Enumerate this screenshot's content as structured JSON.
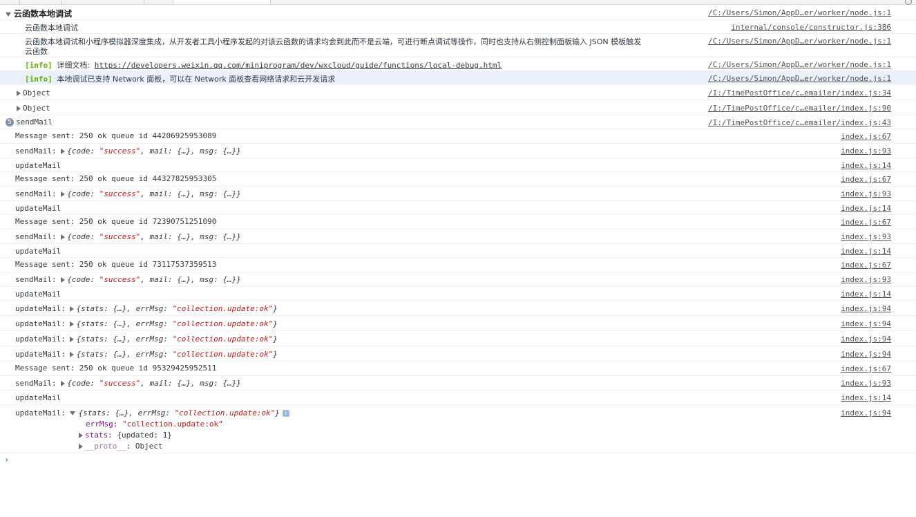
{
  "group": {
    "title": "云函数本地调试",
    "source": "/C:/Users/Simon/AppD…er/worker/node.js:1",
    "lines": [
      {
        "text": "云函数本地调试",
        "source": "internal/console/constructor.js:386"
      },
      {
        "text_1": "云函数本地调试和小程序模拟器深度集成，从开发者工具小程序发起的对该云函数的请求均会到此而不是云端，可进行断点调试等操作，同时也支持从右侧控制面板输入 JSON 模板触发",
        "text_2": "云函数",
        "source": "/C:/Users/Simon/AppD…er/worker/node.js:1"
      },
      {
        "tag": "[info]",
        "label": "详细文档:",
        "url": "https://developers.weixin.qq.com/miniprogram/dev/wxcloud/guide/functions/local-debug.html",
        "source": "/C:/Users/Simon/AppD…er/worker/node.js:1"
      },
      {
        "tag": "[info]",
        "text": "本地调试已支持 Network 面板，可以在 Network 面板查看网络请求和云开发请求",
        "source": "/C:/Users/Simon/AppD…er/worker/node.js:1"
      }
    ]
  },
  "objects": [
    {
      "text": "Object",
      "source": "/I:/TimePostOffice/c…emailer/index.js:34"
    },
    {
      "text": "Object",
      "source": "/I:/TimePostOffice/c…emailer/index.js:90"
    }
  ],
  "sendmail_group": {
    "count": "5",
    "text": "sendMail",
    "source": "/I:/TimePostOffice/c…emailer/index.js:43"
  },
  "logs": [
    {
      "text": "Message sent: 250 ok queue id 44206925953089",
      "source": "index.js:67"
    },
    {
      "label": "sendMail:",
      "open": "{",
      "k1": "code",
      "v1": "\"success\"",
      "rest": ", mail: {…}, msg: {…}}",
      "source": "index.js:93"
    },
    {
      "text": "updateMail",
      "source": "index.js:14"
    },
    {
      "text": "Message sent: 250 ok queue id 44327825953305",
      "source": "index.js:67"
    },
    {
      "label": "sendMail:",
      "open": "{",
      "k1": "code",
      "v1": "\"success\"",
      "rest": ", mail: {…}, msg: {…}}",
      "source": "index.js:93"
    },
    {
      "text": "updateMail",
      "source": "index.js:14"
    },
    {
      "text": "Message sent: 250 ok queue id 72390751251090",
      "source": "index.js:67"
    },
    {
      "label": "sendMail:",
      "open": "{",
      "k1": "code",
      "v1": "\"success\"",
      "rest": ", mail: {…}, msg: {…}}",
      "source": "index.js:93"
    },
    {
      "text": "updateMail",
      "source": "index.js:14"
    },
    {
      "text": "Message sent: 250 ok queue id 73117537359513",
      "source": "index.js:67"
    },
    {
      "label": "sendMail:",
      "open": "{",
      "k1": "code",
      "v1": "\"success\"",
      "rest": ", mail: {…}, msg: {…}}",
      "source": "index.js:93"
    },
    {
      "text": "updateMail",
      "source": "index.js:14"
    },
    {
      "label": "updateMail:",
      "pre": "{stats: {…}, errMsg: ",
      "val": "\"collection.update:ok\"",
      "post": "}",
      "source": "index.js:94"
    },
    {
      "label": "updateMail:",
      "pre": "{stats: {…}, errMsg: ",
      "val": "\"collection.update:ok\"",
      "post": "}",
      "source": "index.js:94"
    },
    {
      "label": "updateMail:",
      "pre": "{stats: {…}, errMsg: ",
      "val": "\"collection.update:ok\"",
      "post": "}",
      "source": "index.js:94"
    },
    {
      "label": "updateMail:",
      "pre": "{stats: {…}, errMsg: ",
      "val": "\"collection.update:ok\"",
      "post": "}",
      "source": "index.js:94"
    },
    {
      "text": "Message sent: 250 ok queue id 95329425952511",
      "source": "index.js:67"
    },
    {
      "label": "sendMail:",
      "open": "{",
      "k1": "code",
      "v1": "\"success\"",
      "rest": ", mail: {…}, msg: {…}}",
      "source": "index.js:93"
    },
    {
      "text": "updateMail",
      "source": "index.js:14"
    }
  ],
  "expanded": {
    "label": "updateMail:",
    "pre": "{stats: {…}, errMsg: ",
    "val": "\"collection.update:ok\"",
    "post": "}",
    "info_icon": "i",
    "source": "index.js:94",
    "props": {
      "errmsg_key": "errMsg",
      "errmsg_val": "\"collection.update:ok\"",
      "stats_key": "stats",
      "stats_pre": "{updated: ",
      "stats_num": "1",
      "stats_post": "}",
      "proto_key": "__proto__",
      "proto_val": "Object"
    }
  },
  "prompt": "›"
}
